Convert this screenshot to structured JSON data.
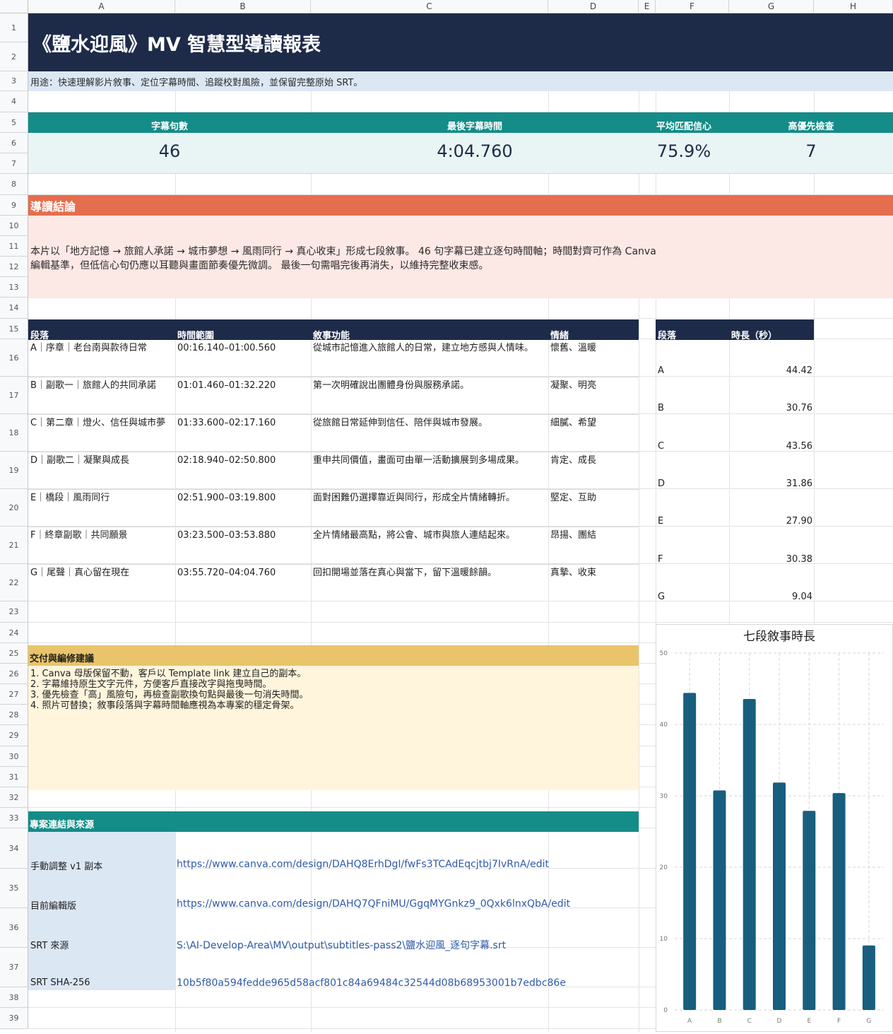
{
  "sheet": {
    "columns": [
      "A",
      "B",
      "C",
      "D",
      "E",
      "F",
      "G",
      "H"
    ],
    "rows": [
      "1",
      "2",
      "3",
      "4",
      "5",
      "6",
      "7",
      "8",
      "9",
      "10",
      "11",
      "12",
      "13",
      "14",
      "15",
      "16",
      "17",
      "18",
      "19",
      "20",
      "21",
      "22",
      "23",
      "24",
      "25",
      "26",
      "27",
      "28",
      "29",
      "30",
      "31",
      "32",
      "33",
      "34",
      "35",
      "36",
      "37",
      "38",
      "39"
    ]
  },
  "report": {
    "title": "《鹽水迎風》MV 智慧型導讀報表",
    "purpose": "用途：快速理解影片敘事、定位字幕時間、追蹤校對風險，並保留完整原始 SRT。"
  },
  "kpis": [
    {
      "label": "字幕句數",
      "value": "46"
    },
    {
      "label": "最後字幕時間",
      "value": "4:04.760"
    },
    {
      "label": "平均匹配信心",
      "value": "75.9%"
    },
    {
      "label": "高優先檢查",
      "value": "7"
    }
  ],
  "conclusion": {
    "heading": "導讀結論",
    "line1": "本片以「地方記憶 → 旅館人承諾 → 城市夢想 → 風雨同行 → 真心收束」形成七段敘事。 46 句字幕已建立逐句時間軸；時間對齊可作為 Canva",
    "line2": "編輯基準，但低信心句仍應以耳聽與畫面節奏優先微調。 最後一句需唱完後再消失，以維持完整收束感。"
  },
  "segments": {
    "headers": {
      "segment": "段落",
      "range": "時間範圍",
      "function": "敘事功能",
      "mood": "情緒"
    },
    "rows": [
      {
        "segment": "A｜序章｜老台南與款待日常",
        "range": "00:16.140–01:00.560",
        "function": "從城市記憶進入旅館人的日常，建立地方感與人情味。",
        "mood": "懷舊、溫暖"
      },
      {
        "segment": "B｜副歌一｜旅館人的共同承諾",
        "range": "01:01.460–01:32.220",
        "function": "第一次明確說出團體身份與服務承諾。",
        "mood": "凝聚、明亮"
      },
      {
        "segment": "C｜第二章｜燈火、信任與城市夢",
        "range": "01:33.600–02:17.160",
        "function": "從旅館日常延伸到信任、陪伴與城市發展。",
        "mood": "細膩、希望"
      },
      {
        "segment": "D｜副歌二｜凝聚與成長",
        "range": "02:18.940–02:50.800",
        "function": "重申共同價值，畫面可由單一活動擴展到多場成果。",
        "mood": "肯定、成長"
      },
      {
        "segment": "E｜橋段｜風雨同行",
        "range": "02:51.900–03:19.800",
        "function": "面對困難仍選擇靠近與同行，形成全片情緒轉折。",
        "mood": "堅定、互助"
      },
      {
        "segment": "F｜終章副歌｜共同願景",
        "range": "03:23.500–03:53.880",
        "function": "全片情緒最高點，將公會、城市與旅人連結起來。",
        "mood": "昂揚、團結"
      },
      {
        "segment": "G｜尾聲｜真心留在現在",
        "range": "03:55.720–04:04.760",
        "function": "回扣開場並落在真心與當下，留下溫暖餘韻。",
        "mood": "真摯、收束"
      }
    ]
  },
  "durations": {
    "headers": {
      "segment": "段落",
      "seconds": "時長（秒）"
    },
    "rows": [
      {
        "segment": "A",
        "seconds": "44.42"
      },
      {
        "segment": "B",
        "seconds": "30.76"
      },
      {
        "segment": "C",
        "seconds": "43.56"
      },
      {
        "segment": "D",
        "seconds": "31.86"
      },
      {
        "segment": "E",
        "seconds": "27.90"
      },
      {
        "segment": "F",
        "seconds": "30.38"
      },
      {
        "segment": "G",
        "seconds": "9.04"
      }
    ]
  },
  "delivery": {
    "heading": "交付與編修建議",
    "items": [
      "1. Canva 母版保留不動，客戶以 Template link 建立自己的副本。",
      "2. 字幕維持原生文字元件，方便客戶直接改字與拖曳時間。",
      "3. 優先檢查「高」風險句，再檢查副歌換句點與最後一句消失時間。",
      "4. 照片可替換；敘事段落與字幕時間軸應視為本專案的穩定骨架。"
    ]
  },
  "links": {
    "heading": "專案連結與來源",
    "rows": [
      {
        "label": "手動調整 v1 副本",
        "value": "https://www.canva.com/design/DAHQ8ErhDgI/fwFs3TCAdEqcjtbj7IvRnA/edit"
      },
      {
        "label": "目前編輯版",
        "value": "https://www.canva.com/design/DAHQ7QFniMU/GgqMYGnkz9_0Qxk6lnxQbA/edit"
      },
      {
        "label": "SRT 來源",
        "value": "S:\\AI-Develop-Area\\MV\\output\\subtitles-pass2\\鹽水迎風_逐句字幕.srt"
      },
      {
        "label": "SRT SHA-256",
        "value": "10b5f80a594fedde965d58acf801c84a69484c32544d08b68953001b7edbc86e"
      }
    ]
  },
  "chart_data": {
    "type": "bar",
    "title": "七段敘事時長",
    "categories": [
      "A",
      "B",
      "C",
      "D",
      "E",
      "F",
      "G"
    ],
    "values": [
      44.42,
      30.76,
      43.56,
      31.86,
      27.9,
      30.38,
      9.04
    ],
    "yticks": [
      "0",
      "10",
      "20",
      "30",
      "40",
      "50"
    ],
    "ylim": [
      0,
      50
    ],
    "xlabel": "",
    "ylabel": "",
    "grid": true,
    "legend": "none",
    "bar_color": "#175e7f"
  }
}
